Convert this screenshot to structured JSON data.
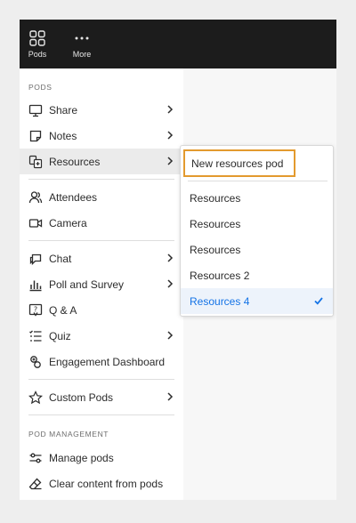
{
  "topbar": {
    "pods_label": "Pods",
    "more_label": "More"
  },
  "menu": {
    "pods_section": "PODS",
    "items": [
      {
        "label": "Share",
        "icon": "share-screen-icon",
        "has_submenu": true
      },
      {
        "label": "Notes",
        "icon": "notes-icon",
        "has_submenu": true
      },
      {
        "label": "Resources",
        "icon": "resources-icon",
        "has_submenu": true
      },
      {
        "label": "Attendees",
        "icon": "attendees-icon",
        "has_submenu": false
      },
      {
        "label": "Camera",
        "icon": "camera-icon",
        "has_submenu": false
      },
      {
        "label": "Chat",
        "icon": "chat-icon",
        "has_submenu": true
      },
      {
        "label": "Poll and Survey",
        "icon": "poll-icon",
        "has_submenu": true
      },
      {
        "label": "Q & A",
        "icon": "qa-icon",
        "has_submenu": false
      },
      {
        "label": "Quiz",
        "icon": "quiz-icon",
        "has_submenu": true
      },
      {
        "label": "Engagement Dashboard",
        "icon": "engagement-icon",
        "has_submenu": false
      },
      {
        "label": "Custom Pods",
        "icon": "star-icon",
        "has_submenu": true
      }
    ],
    "management_section": "POD MANAGEMENT",
    "management_items": [
      {
        "label": "Manage pods",
        "icon": "sliders-icon"
      },
      {
        "label": "Clear content from pods",
        "icon": "eraser-icon"
      }
    ]
  },
  "submenu": {
    "new_label": "New resources pod",
    "items": [
      {
        "label": "Resources",
        "selected": false
      },
      {
        "label": "Resources",
        "selected": false
      },
      {
        "label": "Resources",
        "selected": false
      },
      {
        "label": "Resources 2",
        "selected": false
      },
      {
        "label": "Resources 4",
        "selected": true
      }
    ]
  },
  "colors": {
    "highlight_border": "#e39a2e",
    "selected_text": "#1473e6",
    "topbar": "#1c1c1c"
  }
}
